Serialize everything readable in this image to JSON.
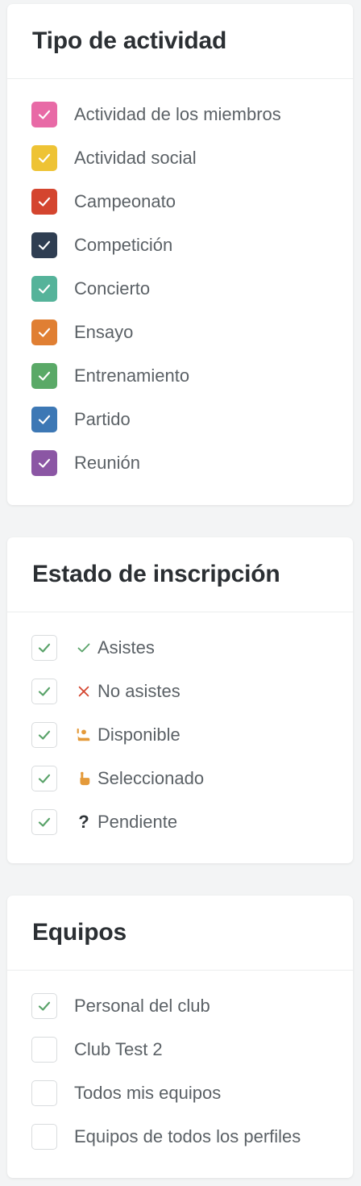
{
  "activity_type": {
    "title": "Tipo de actividad",
    "items": [
      {
        "label": "Actividad de los miembros",
        "color": "#e86aa6",
        "checked": true
      },
      {
        "label": "Actividad social",
        "color": "#eec335",
        "checked": true
      },
      {
        "label": "Campeonato",
        "color": "#d4452f",
        "checked": true
      },
      {
        "label": "Competición",
        "color": "#2f3e52",
        "checked": true
      },
      {
        "label": "Concierto",
        "color": "#55b39a",
        "checked": true
      },
      {
        "label": "Ensayo",
        "color": "#e07f33",
        "checked": true
      },
      {
        "label": "Entrenamiento",
        "color": "#5aa967",
        "checked": true
      },
      {
        "label": "Partido",
        "color": "#3d78b5",
        "checked": true
      },
      {
        "label": "Reunión",
        "color": "#8b56a4",
        "checked": true
      }
    ]
  },
  "registration_status": {
    "title": "Estado de inscripción",
    "items": [
      {
        "label": "Asistes",
        "icon": "check-icon",
        "icon_color": "#5aa36a",
        "checked": true
      },
      {
        "label": "No asistes",
        "icon": "cross-icon",
        "icon_color": "#d4452f",
        "checked": true
      },
      {
        "label": "Disponible",
        "icon": "raised-hand-person-icon",
        "icon_color": "#e49a3a",
        "checked": true
      },
      {
        "label": "Seleccionado",
        "icon": "pointing-hand-icon",
        "icon_color": "#e49a3a",
        "checked": true
      },
      {
        "label": "Pendiente",
        "icon": "question-icon",
        "icon_color": "#2f3438",
        "checked": true
      }
    ]
  },
  "teams": {
    "title": "Equipos",
    "items": [
      {
        "label": "Personal del club",
        "checked": true
      },
      {
        "label": "Club Test 2",
        "checked": false
      },
      {
        "label": "Todos mis equipos",
        "checked": false
      },
      {
        "label": "Equipos de todos los perfiles",
        "checked": false
      }
    ]
  }
}
